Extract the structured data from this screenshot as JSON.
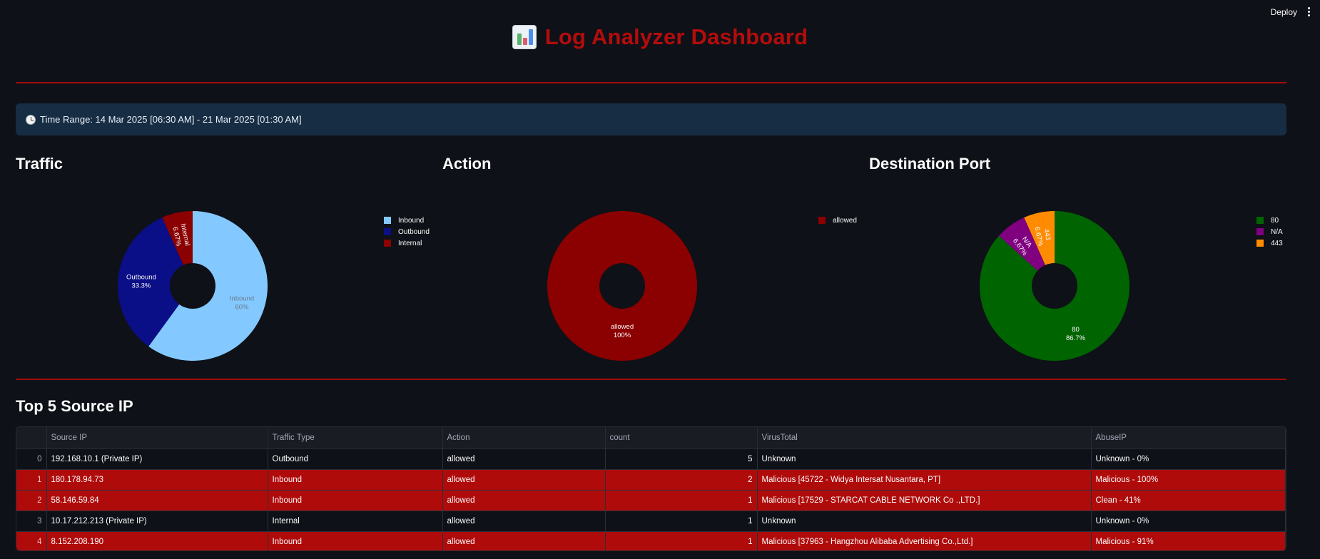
{
  "header": {
    "deploy_label": "Deploy",
    "menu_icon": "vertical-ellipsis-icon"
  },
  "title": {
    "icon": "bar-chart-icon",
    "text": "Log Analyzer Dashboard",
    "color": "#b30c0c"
  },
  "time_range": {
    "icon": "clock-icon",
    "text": "Time Range: 14 Mar 2025 [06:30 AM] - 21 Mar 2025 [01:30 AM]"
  },
  "sections": {
    "traffic": "Traffic",
    "action": "Action",
    "port": "Destination Port",
    "top_ips": "Top 5 Source IP"
  },
  "chart_data": [
    {
      "type": "pie",
      "title": "Traffic",
      "categories": [
        "Inbound",
        "Outbound",
        "Internal"
      ],
      "values": [
        60,
        33.3,
        6.67
      ],
      "labels": [
        "60%",
        "33.3%",
        "6.67%"
      ],
      "colors": [
        "#83c9ff",
        "#0a0e87",
        "#8b0000"
      ],
      "donut": true,
      "legend": "right"
    },
    {
      "type": "pie",
      "title": "Action",
      "categories": [
        "allowed"
      ],
      "values": [
        100
      ],
      "labels": [
        "100%"
      ],
      "colors": [
        "#8b0000"
      ],
      "donut": true,
      "legend": "right"
    },
    {
      "type": "pie",
      "title": "Destination Port",
      "categories": [
        "80",
        "N/A",
        "443"
      ],
      "values": [
        86.7,
        6.67,
        6.67
      ],
      "labels": [
        "86.7%",
        "6.67%",
        "6.67%"
      ],
      "colors": [
        "#006400",
        "#800080",
        "#ff8c00"
      ],
      "donut": true,
      "legend": "right"
    }
  ],
  "table": {
    "columns": [
      "",
      "Source IP",
      "Traffic Type",
      "Action",
      "count",
      "VirusTotal",
      "AbuseIP"
    ],
    "rows": [
      {
        "idx": "0",
        "ip": "192.168.10.1 (Private IP)",
        "type": "Outbound",
        "action": "allowed",
        "count": "5",
        "vt": "Unknown",
        "abuse": "Unknown - 0%",
        "malicious": false
      },
      {
        "idx": "1",
        "ip": "180.178.94.73",
        "type": "Inbound",
        "action": "allowed",
        "count": "2",
        "vt": "Malicious [45722 - Widya Intersat Nusantara, PT]",
        "abuse": "Malicious - 100%",
        "malicious": true
      },
      {
        "idx": "2",
        "ip": "58.146.59.84",
        "type": "Inbound",
        "action": "allowed",
        "count": "1",
        "vt": "Malicious [17529 - STARCAT CABLE NETWORK Co .,LTD.]",
        "abuse": "Clean - 41%",
        "malicious": true
      },
      {
        "idx": "3",
        "ip": "10.17.212.213 (Private IP)",
        "type": "Internal",
        "action": "allowed",
        "count": "1",
        "vt": "Unknown",
        "abuse": "Unknown - 0%",
        "malicious": false
      },
      {
        "idx": "4",
        "ip": "8.152.208.190",
        "type": "Inbound",
        "action": "allowed",
        "count": "1",
        "vt": "Malicious [37963 - Hangzhou Alibaba Advertising Co.,Ltd.]",
        "abuse": "Malicious - 91%",
        "malicious": true
      }
    ]
  }
}
